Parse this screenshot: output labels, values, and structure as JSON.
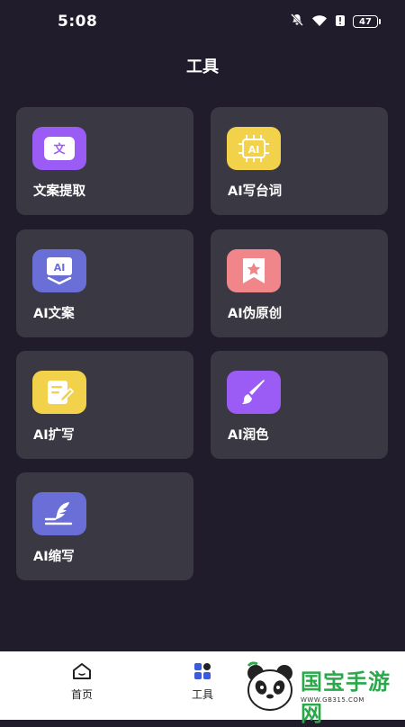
{
  "status_bar": {
    "time": "5:08",
    "battery": "47",
    "icons": [
      "bell-off-icon",
      "wifi-icon",
      "alert-icon",
      "battery-icon"
    ]
  },
  "page": {
    "title": "工具"
  },
  "tools": [
    {
      "label": "文案提取",
      "icon": "text-extract-icon",
      "glyph": "文",
      "color": "#9b5cf6"
    },
    {
      "label": "AI写台词",
      "icon": "ai-chip-icon",
      "glyph": "AI",
      "color": "#f2d24a"
    },
    {
      "label": "AI文案",
      "icon": "ai-copy-icon",
      "glyph": "AI",
      "color": "#6a6fd8"
    },
    {
      "label": "AI伪原创",
      "icon": "star-bookmark-icon",
      "color": "#f0868a"
    },
    {
      "label": "AI扩写",
      "icon": "note-edit-icon",
      "color": "#f2d24a"
    },
    {
      "label": "AI润色",
      "icon": "brush-icon",
      "color": "#9b5cf6"
    },
    {
      "label": "AI缩写",
      "icon": "quill-icon",
      "color": "#6a6fd8"
    }
  ],
  "bottom_nav": {
    "items": [
      {
        "label": "首页",
        "icon": "home-icon"
      },
      {
        "label": "工具",
        "icon": "apps-icon"
      }
    ]
  },
  "watermark": {
    "brand": "国宝手游网",
    "url": "WWW.GB315.COM"
  }
}
